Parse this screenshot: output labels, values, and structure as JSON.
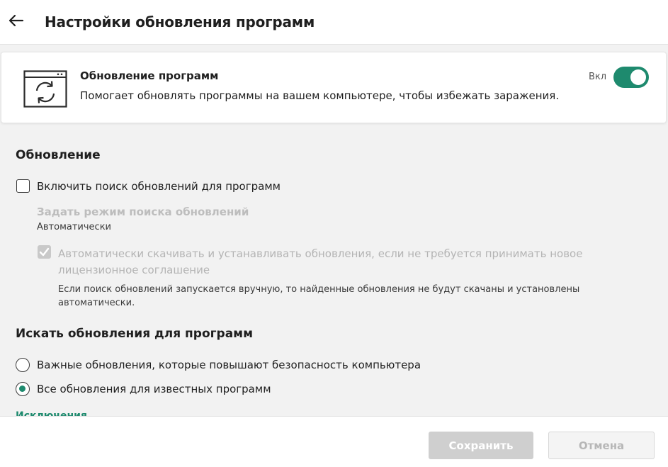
{
  "header": {
    "title": "Настройки обновления программ",
    "back_icon": "arrow-left-icon"
  },
  "feature_card": {
    "icon": "window-refresh-icon",
    "title": "Обновление программ",
    "description": "Помогает обновлять программы на вашем компьютере, чтобы избежать заражения.",
    "toggle_label": "Вкл",
    "toggle_on": true,
    "accent_color": "#1e8a6e"
  },
  "update_section": {
    "title": "Обновление",
    "enable_search": {
      "label": "Включить поиск обновлений для программ",
      "checked": false
    },
    "search_mode": {
      "label": "Задать режим поиска обновлений",
      "value": "Автоматически"
    },
    "auto_install": {
      "label": "Автоматически скачивать и устанавливать обновления, если не требуется принимать новое лицензионное соглашение",
      "checked": true,
      "disabled": true
    },
    "note": "Если поиск обновлений запускается вручную, то найденные обновления не будут скачаны и установлены автоматически."
  },
  "search_section": {
    "title": "Искать обновления для программ",
    "options": [
      {
        "label": "Важные обновления, которые повышают безопасность компьютера",
        "selected": false
      },
      {
        "label": "Все обновления для известных программ",
        "selected": true
      }
    ],
    "exclusions_link": "Исключения"
  },
  "footer": {
    "save_label": "Сохранить",
    "cancel_label": "Отмена"
  }
}
